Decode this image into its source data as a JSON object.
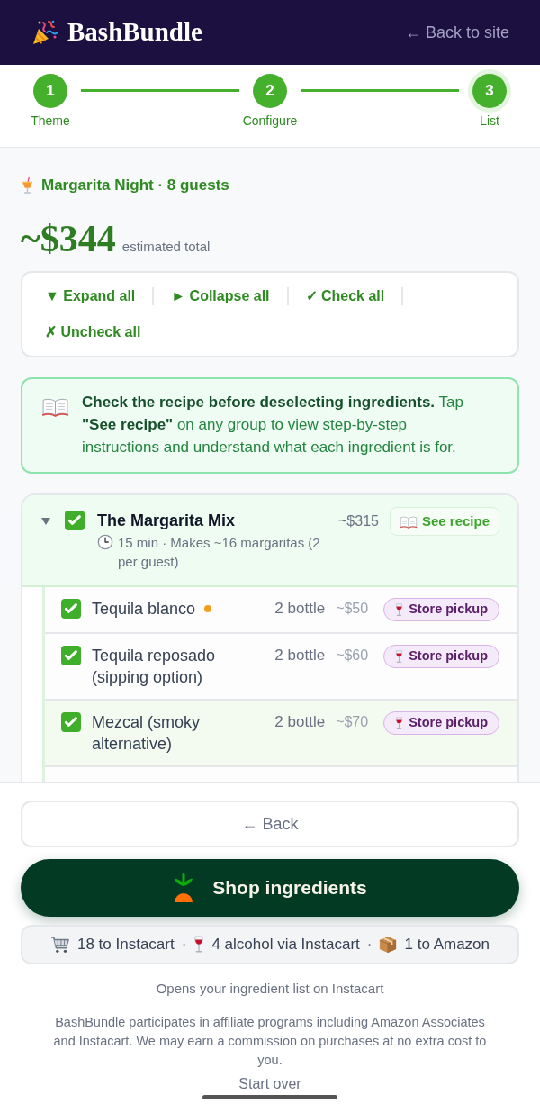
{
  "header": {
    "logo": "BashBundle",
    "back_link": "← Back to site"
  },
  "stepper": {
    "steps": [
      {
        "number": "1",
        "label": "Theme",
        "done": true,
        "selected": false
      },
      {
        "number": "2",
        "label": "Configure",
        "done": true,
        "selected": false
      },
      {
        "number": "3",
        "label": "List",
        "done": false,
        "selected": true
      }
    ]
  },
  "event": {
    "title": "Margarita Night · 8 guests"
  },
  "estimate": {
    "total": "~$344",
    "caption": "estimated total"
  },
  "toolbar": {
    "actions": [
      "▼ Expand all",
      "► Collapse all",
      "✓ Check all",
      "✗ Uncheck all"
    ]
  },
  "notice": {
    "text": "**Check the recipe before deselecting ingredients.** Tap **\"See recipe\"** on any group to view step-by-step instructions and understand what each ingredient is for."
  },
  "groups": [
    {
      "title": "The Margarita Mix",
      "checked": true,
      "expanded": true,
      "meta": "15 min · Makes ~16 margaritas (2 per guest)",
      "price": "~$315",
      "recipe_button": "See recipe",
      "items": [
        {
          "name": "Tequila blanco",
          "checked": true,
          "highlighted": false,
          "color": "#f0a01e",
          "quantity": "2 bottle",
          "price": "~$50",
          "badge": "Store pickup"
        },
        {
          "name": "Tequila reposado (sipping option)",
          "checked": true,
          "highlighted": false,
          "quantity": "2 bottle",
          "price": "~$60",
          "badge": "Store pickup"
        },
        {
          "name": "Mezcal (smoky alternative)",
          "checked": true,
          "highlighted": true,
          "quantity": "2 bottle",
          "price": "~$70",
          "badge": "Store pickup"
        }
      ]
    }
  ],
  "footer": {
    "back_button": "← Back",
    "shop_button": "Shop ingredients",
    "summary": {
      "separator": "·",
      "items": [
        {
          "kind": "cart",
          "text": "18 to Instacart"
        },
        {
          "kind": "wine",
          "text": "4 alcohol via Instacart"
        },
        {
          "kind": "package",
          "text": "1 to Amazon"
        }
      ]
    },
    "caption": "Opens your ingredient list on Instacart",
    "disclaimer": "BashBundle participates in affiliate programs including Amazon Associates and Instacart. We may earn a commission on purchases at no extra cost to you.",
    "start_over": "Start over"
  }
}
